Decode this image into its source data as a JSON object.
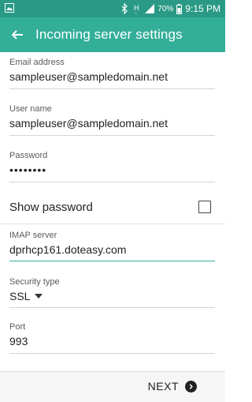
{
  "status_bar": {
    "battery_percent": "70%",
    "time": "9:15 PM",
    "icons": [
      "gallery-icon",
      "bluetooth-icon",
      "h-signal-icon",
      "signal-bars-icon",
      "battery-icon"
    ]
  },
  "app_bar": {
    "title": "Incoming server settings",
    "back_icon": "arrow-left-icon"
  },
  "form": {
    "email": {
      "label": "Email address",
      "value": "sampleuser@sampledomain.net"
    },
    "username": {
      "label": "User name",
      "value": "sampleuser@sampledomain.net"
    },
    "password": {
      "label": "Password",
      "value": "••••••••"
    },
    "show_password": {
      "label": "Show password",
      "checked": false
    },
    "imap_server": {
      "label": "IMAP server",
      "value": "dprhcp161.doteasy.com"
    },
    "security_type": {
      "label": "Security type",
      "value": "SSL"
    },
    "port": {
      "label": "Port",
      "value": "993"
    }
  },
  "bottom_bar": {
    "next_label": "NEXT",
    "next_icon": "chevron-right-circle-icon"
  },
  "colors": {
    "status_bar": "#2a9a86",
    "app_bar": "#33af99",
    "accent": "#33af99"
  }
}
